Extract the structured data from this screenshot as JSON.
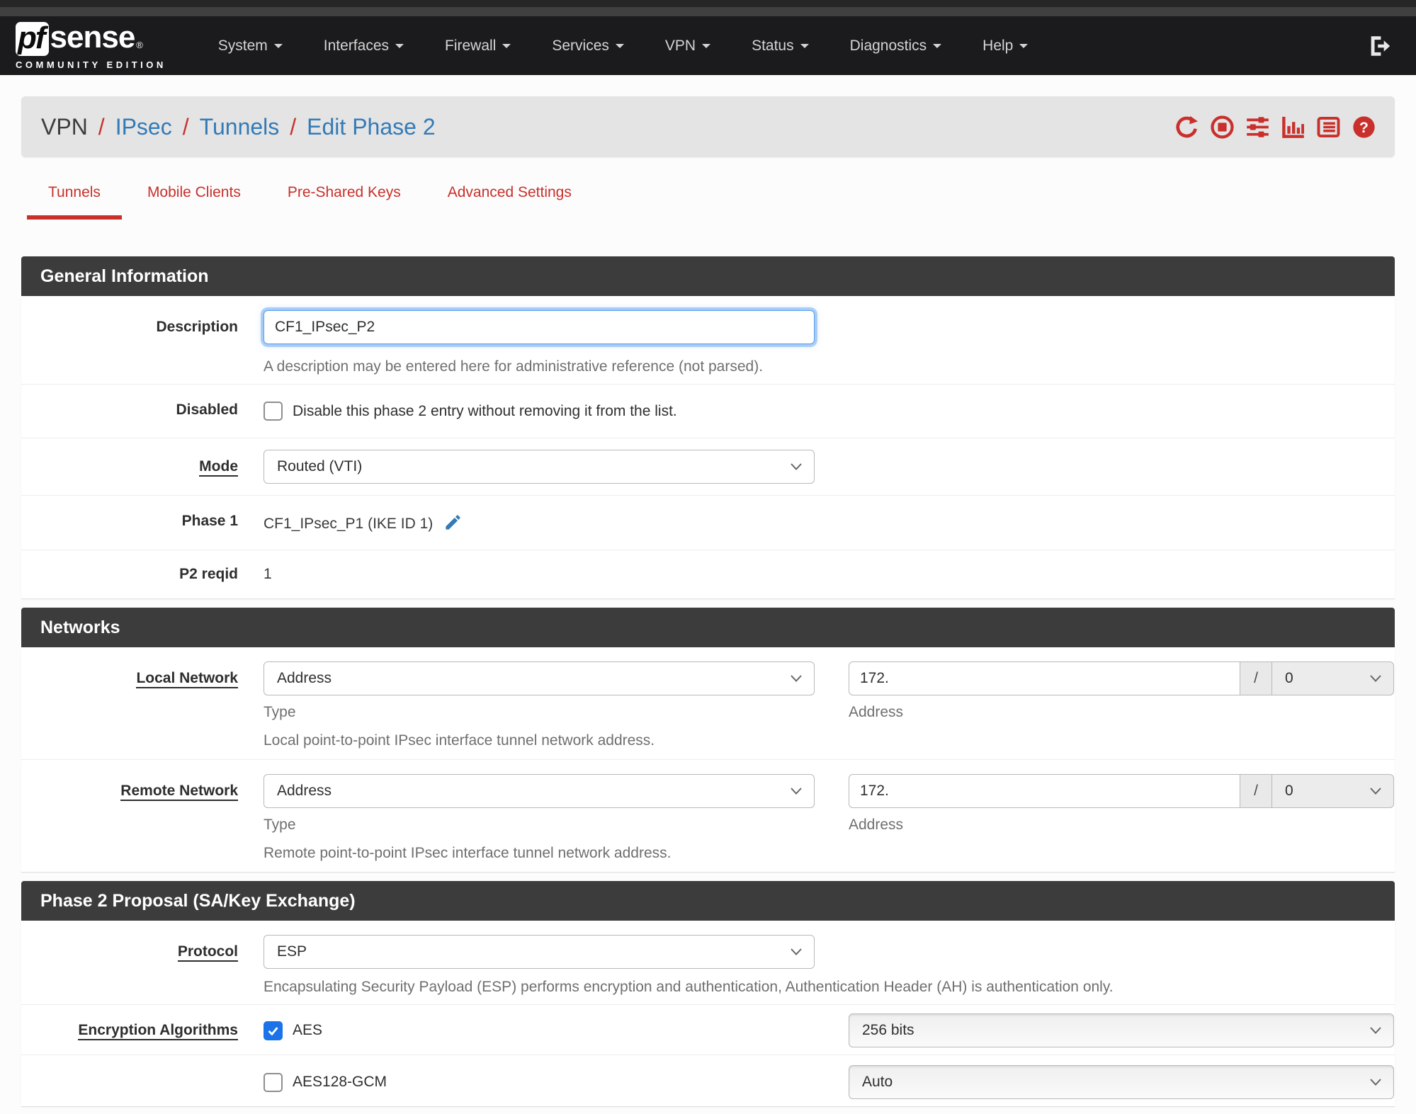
{
  "navbar": {
    "brand_pf": "pf",
    "brand_sense": "sense",
    "brand_reg": "®",
    "brand_edition": "COMMUNITY EDITION",
    "items": [
      {
        "label": "System"
      },
      {
        "label": "Interfaces"
      },
      {
        "label": "Firewall"
      },
      {
        "label": "Services"
      },
      {
        "label": "VPN"
      },
      {
        "label": "Status"
      },
      {
        "label": "Diagnostics"
      },
      {
        "label": "Help"
      }
    ]
  },
  "breadcrumb": {
    "crumbs": [
      {
        "label": "VPN"
      },
      {
        "label": "IPsec"
      },
      {
        "label": "Tunnels"
      },
      {
        "label": "Edit Phase 2"
      }
    ],
    "separator": "/",
    "action_icons": [
      "refresh-icon",
      "stop-icon",
      "sliders-icon",
      "bar-chart-icon",
      "log-list-icon",
      "help-icon"
    ]
  },
  "tabs": [
    {
      "label": "Tunnels",
      "active": true
    },
    {
      "label": "Mobile Clients",
      "active": false
    },
    {
      "label": "Pre-Shared Keys",
      "active": false
    },
    {
      "label": "Advanced Settings",
      "active": false
    }
  ],
  "general": {
    "title": "General Information",
    "description_label": "Description",
    "description_value": "CF1_IPsec_P2",
    "description_help": "A description may be entered here for administrative reference (not parsed).",
    "disabled_label": "Disabled",
    "disabled_checkbox_label": "Disable this phase 2 entry without removing it from the list.",
    "disabled_checked": false,
    "mode_label": "Mode",
    "mode_value": "Routed (VTI)",
    "phase1_label": "Phase 1",
    "phase1_value": "CF1_IPsec_P1 (IKE ID 1)",
    "p2reqid_label": "P2 reqid",
    "p2reqid_value": "1"
  },
  "networks": {
    "title": "Networks",
    "local": {
      "label": "Local Network",
      "type_value": "Address",
      "type_sublabel": "Type",
      "address_value": "172.",
      "address_sublabel": "Address",
      "mask_separator": "/",
      "mask_value": "0",
      "help": "Local point-to-point IPsec interface tunnel network address."
    },
    "remote": {
      "label": "Remote Network",
      "type_value": "Address",
      "type_sublabel": "Type",
      "address_value": "172.",
      "address_sublabel": "Address",
      "mask_separator": "/",
      "mask_value": "0",
      "help": "Remote point-to-point IPsec interface tunnel network address."
    }
  },
  "proposal": {
    "title": "Phase 2 Proposal (SA/Key Exchange)",
    "protocol_label": "Protocol",
    "protocol_value": "ESP",
    "protocol_help": "Encapsulating Security Payload (ESP) performs encryption and authentication, Authentication Header (AH) is authentication only.",
    "encryption_label": "Encryption Algorithms",
    "algorithms": [
      {
        "name": "AES",
        "checked": true,
        "keylen": "256 bits"
      },
      {
        "name": "AES128-GCM",
        "checked": false,
        "keylen": "Auto"
      }
    ]
  },
  "colors": {
    "accent_red": "#c9302c",
    "link_blue": "#337ab7",
    "checkbox_blue": "#1a73e8",
    "panel_header_bg": "#3c3c3c",
    "navbar_bg": "#1b1b1d"
  }
}
